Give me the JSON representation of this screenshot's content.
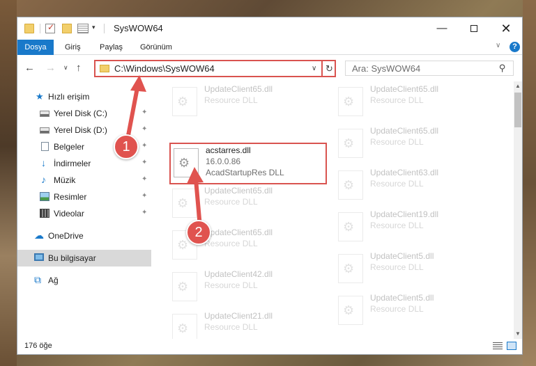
{
  "window": {
    "title": "SysWOW64",
    "minimize_glyph": "—",
    "close_glyph": "✕"
  },
  "ribbon": {
    "tabs": [
      "Dosya",
      "Giriş",
      "Paylaş",
      "Görünüm"
    ],
    "help_label": "?"
  },
  "navigation": {
    "back_glyph": "←",
    "forward_glyph": "→",
    "recent_glyph": "∨",
    "up_glyph": "↑",
    "address_path": "C:\\Windows\\SysWOW64",
    "address_dropdown_glyph": "∨",
    "refresh_glyph": "↻",
    "search_placeholder": "Ara: SysWOW64",
    "search_glyph": "⚲"
  },
  "sidebar": {
    "items": [
      {
        "label": "Hızlı erişim",
        "icon": "star-icon",
        "glyph": "★"
      },
      {
        "label": "Yerel Disk (C:)",
        "icon": "disk-icon",
        "pinned": true
      },
      {
        "label": "Yerel Disk (D:)",
        "icon": "disk-icon",
        "pinned": true
      },
      {
        "label": "Belgeler",
        "icon": "documents-icon",
        "pinned": true
      },
      {
        "label": "İndirmeler",
        "icon": "downloads-icon",
        "glyph": "↓",
        "pinned": true
      },
      {
        "label": "Müzik",
        "icon": "music-icon",
        "glyph": "♪",
        "pinned": true
      },
      {
        "label": "Resimler",
        "icon": "pictures-icon",
        "pinned": true
      },
      {
        "label": "Videolar",
        "icon": "videos-icon",
        "pinned": true
      },
      {
        "label": "OneDrive",
        "icon": "onedrive-icon",
        "glyph": "☁"
      },
      {
        "label": "Bu bilgisayar",
        "icon": "computer-icon",
        "selected": true
      },
      {
        "label": "Ağ",
        "icon": "network-icon",
        "glyph": "⧉"
      }
    ],
    "pin_glyph": "✦"
  },
  "files": {
    "highlighted": {
      "name": "acstarres.dll",
      "version": "16.0.0.86",
      "description": "AcadStartupRes DLL"
    },
    "left_column": [
      {
        "name": "UpdateClient65.dll",
        "type": "Resource DLL"
      },
      {
        "name": "UpdateClient65.dll",
        "type": "Resource DLL"
      },
      {
        "name": "UpdateClient65.dll",
        "type": "Resource DLL"
      },
      {
        "name": "UpdateClient42.dll",
        "type": "Resource DLL"
      },
      {
        "name": "UpdateClient21.dll",
        "type": "Resource DLL"
      }
    ],
    "right_column": [
      {
        "name": "UpdateClient65.dll",
        "type": "Resource DLL"
      },
      {
        "name": "UpdateClient65.dll",
        "type": "Resource DLL"
      },
      {
        "name": "UpdateClient63.dll",
        "type": "Resource DLL"
      },
      {
        "name": "UpdateClient19.dll",
        "type": "Resource DLL"
      },
      {
        "name": "UpdateClient5.dll",
        "type": "Resource DLL"
      },
      {
        "name": "UpdateClient5.dll",
        "type": "Resource DLL"
      }
    ],
    "file_icon": "dll-gear-icon",
    "gear_glyph": "⚙"
  },
  "status": {
    "item_count": "176 öğe"
  },
  "callouts": {
    "step1": "1",
    "step2": "2",
    "color": "#e0534f"
  },
  "colors": {
    "accent": "#1979ca",
    "highlight_border": "#d9534f"
  }
}
